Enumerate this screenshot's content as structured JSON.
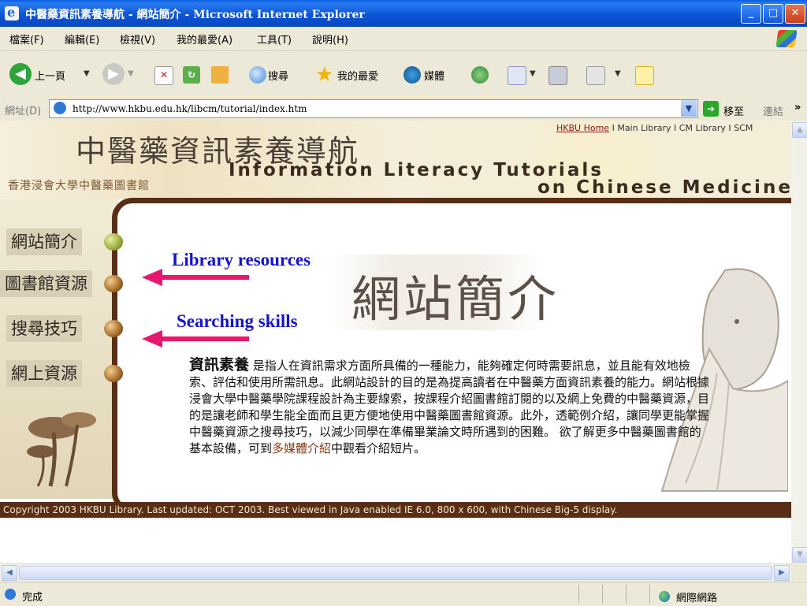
{
  "window": {
    "title": "中醫藥資訊素養導航 - 網站簡介 - Microsoft Internet Explorer",
    "controls": {
      "minimize": "_",
      "maximize": "□",
      "close": "✕"
    }
  },
  "menubar": {
    "items": [
      "檔案(F)",
      "編輯(E)",
      "檢視(V)",
      "我的最愛(A)",
      "工具(T)",
      "說明(H)"
    ]
  },
  "toolbar": {
    "back_label": "上一頁",
    "search_label": "搜尋",
    "favorites_label": "我的最愛",
    "media_label": "媒體"
  },
  "addressbar": {
    "label": "網址(D)",
    "url": "http://www.hkbu.edu.hk/libcm/tutorial/index.htm",
    "go_label": "移至",
    "links_label": "連結",
    "links_more": "»"
  },
  "page": {
    "site_title_zh": "中醫藥資訊素養導航",
    "site_subtitle_zh": "香港浸會大學中醫藥圖書館",
    "site_title_en_line1": "Information Literacy Tutorials",
    "site_title_en_line2": "on Chinese Medicine",
    "toplinks": {
      "hkbu_home": "HKBU Home",
      "sep": " I ",
      "main_library": "Main Library",
      "cm_library": "CM Library",
      "scm": "SCM"
    },
    "nav": [
      {
        "label": "網站簡介",
        "color": "#9aa83a"
      },
      {
        "label": "圖書館資源",
        "color": "#a36a28"
      },
      {
        "label": "搜尋技巧",
        "color": "#a36a28"
      },
      {
        "label": "網上資源",
        "color": "#a36a28"
      }
    ],
    "section_title": "網站簡介",
    "annotations": {
      "library_resources": "Library resources",
      "searching_skills": "Searching skills"
    },
    "description": {
      "term": "資訊素養",
      "text_before_link": " 是指人在資訊需求方面所具備的一種能力，能夠確定何時需要訊息，並且能有效地檢索、評估和使用所需訊息。此網站設計的目的是為提高讀者在中醫藥方面資訊素養的能力。網站根據浸會大學中醫藥學院課程設計為主要線索，按課程介紹圖書館訂閱的以及網上免費的中醫藥資源，目的是讓老師和學生能全面而且更方便地使用中醫藥圖書館資源。此外，透範例介紹，讓同學更能掌握中醫藥資源之搜尋技巧，以減少同學在準備畢業論文時所遇到的困難。 欲了解更多中醫藥圖書館的基本設備，可到",
      "link_text": "多媒體介紹",
      "text_after_link": "中觀看介紹短片。"
    },
    "copyright": "Copyright 2003 HKBU Library. Last updated: OCT 2003. Best viewed in Java enabled IE 6.0, 800 x 600, with Chinese Big-5 display."
  },
  "statusbar": {
    "status": "完成",
    "zone": "網際網路"
  },
  "colors": {
    "titlebar": "#0a5ee0",
    "frame_brown": "#5a2e14",
    "annotation_blue": "#1414cc",
    "arrow_pink": "#e8176e"
  }
}
